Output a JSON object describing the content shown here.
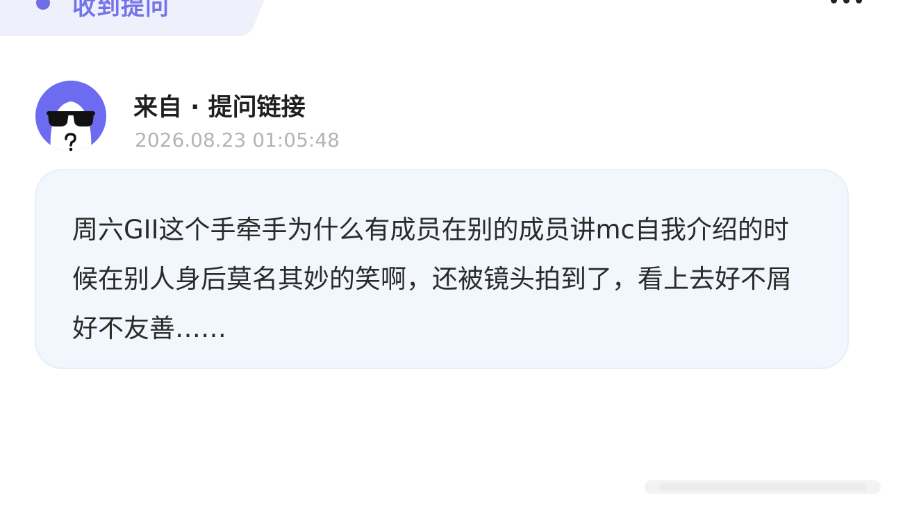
{
  "header": {
    "badge_title": "收到提问",
    "more_icon": "more-dots-icon"
  },
  "question": {
    "avatar_icon": "anonymous-sunglasses-avatar",
    "source": "来自 · 提问链接",
    "timestamp": "2026.08.23 01:05:48",
    "body": "周六GII这个手牵手为什么有成员在别的成员讲mc自我介绍的时候在别人身后莫名其妙的笑啊，还被镜头拍到了，看上去好不屑好不友善……"
  },
  "colors": {
    "accent": "#6d6cf0",
    "badge_bg": "#eef0fb",
    "card_bg": "#f2f7fd",
    "timestamp": "#b4b4b4"
  }
}
